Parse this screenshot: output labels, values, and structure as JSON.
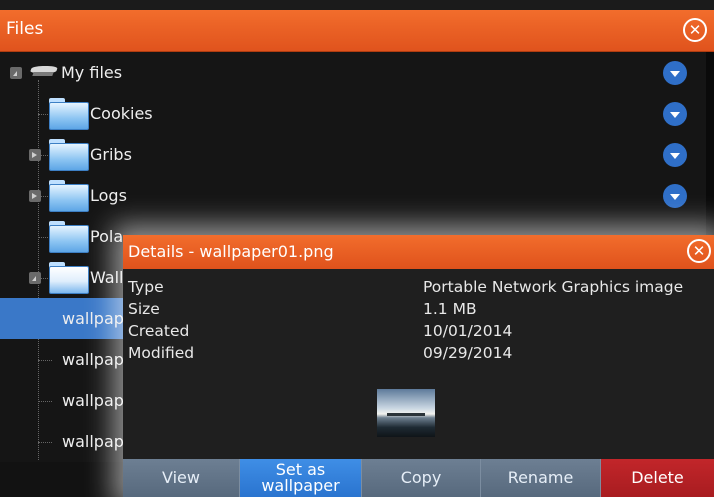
{
  "window": {
    "title": "Files",
    "close_glyph": "✕"
  },
  "tree": {
    "root": {
      "label": "My files",
      "icon": "drive-icon"
    },
    "items": [
      {
        "label": "Cookies",
        "icon": "folder-icon"
      },
      {
        "label": "Gribs",
        "icon": "folder-icon"
      },
      {
        "label": "Logs",
        "icon": "folder-icon"
      },
      {
        "label": "Pola",
        "icon": "folder-icon"
      },
      {
        "label": "Wall",
        "icon": "folder-open-icon"
      },
      {
        "label": "wallpap",
        "selected": true
      },
      {
        "label": "wallpap"
      },
      {
        "label": "wallpap"
      },
      {
        "label": "wallpap"
      }
    ]
  },
  "details": {
    "title": "Details - wallpaper01.png",
    "close_glyph": "✕",
    "fields": [
      {
        "key": "Type",
        "value": "Portable Network Graphics image"
      },
      {
        "key": "Size",
        "value": "1.1 MB"
      },
      {
        "key": "Created",
        "value": "10/01/2014"
      },
      {
        "key": "Modified",
        "value": "09/29/2014"
      }
    ],
    "actions": {
      "view": "View",
      "set_wallpaper_line1": "Set as",
      "set_wallpaper_line2": "wallpaper",
      "copy": "Copy",
      "rename": "Rename",
      "delete": "Delete"
    }
  },
  "colors": {
    "header_orange": "#e85d22",
    "selection_blue": "#3a78c8",
    "delete_red": "#b42125",
    "primary_blue": "#2f7fda"
  }
}
